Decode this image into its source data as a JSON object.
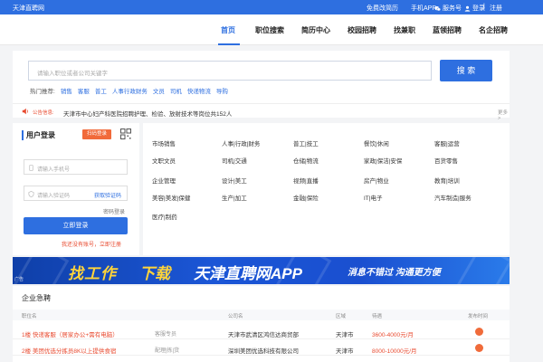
{
  "topbar": {
    "site_name": "天津直聘网",
    "links": [
      {
        "label": "免费改简历"
      },
      {
        "label": "手机APP"
      },
      {
        "label": "服务号"
      },
      {
        "label": "登录"
      },
      {
        "label": "注册"
      }
    ],
    "separator": "|"
  },
  "nav": {
    "items": [
      {
        "label": "首页",
        "active": true
      },
      {
        "label": "职位搜索"
      },
      {
        "label": "简历中心"
      },
      {
        "label": "校园招聘"
      },
      {
        "label": "找兼职"
      },
      {
        "label": "蓝领招聘"
      },
      {
        "label": "名企招聘"
      }
    ]
  },
  "search": {
    "placeholder": "请输入职位或者公司关键字",
    "button": "搜 索",
    "hot_label": "热门推荐:",
    "hot_keywords": [
      "销售",
      "客服",
      "普工",
      "人事行政财务",
      "文员",
      "司机",
      "快递物流",
      "导购"
    ]
  },
  "notice": {
    "label": "公告信息:",
    "text": "天津市中心妇产科医院招聘护理、检验、放射技术等岗位共152人",
    "more": "更多 >"
  },
  "login": {
    "title": "用户登录",
    "scan_button": "扫码登录",
    "phone_placeholder": "请输入手机号",
    "code_placeholder": "请输入验证码",
    "get_code": "获取验证码",
    "password_login": "密码登录",
    "submit": "立即登录",
    "register": "我还没有账号，立即注册"
  },
  "categories": [
    [
      "市场销售",
      "人事|行政|财务",
      "普工|技工",
      "餐饮|休闲",
      "客服|运营"
    ],
    [
      "文职文员",
      "司机|交通",
      "仓储|物流",
      "家政|保洁|安保",
      "百货零售"
    ],
    [
      "企业管理",
      "设计|美工",
      "视频|直播",
      "房产|物业",
      "教育|培训"
    ],
    [
      "美容|美发|保健",
      "生产|加工",
      "金融|保险",
      "IT|电子",
      "汽车制造|服务"
    ],
    [
      "医疗|制药"
    ]
  ],
  "banner": {
    "text1": "找工作",
    "text2": "下载",
    "text3": "天津直聘网APP",
    "text4": "消息不错过  沟通更方便",
    "ad": "广告"
  },
  "jobs": {
    "heading": "企业急聘",
    "columns": [
      "职位名",
      "公司名",
      "区域",
      "待遇",
      "发布时间"
    ],
    "rows": [
      {
        "title": "1楼  快递客服（居家办公+需有电脑）",
        "tag": "客服专员",
        "company": "天津市武清区鸿信达商贸部",
        "area": "天津市",
        "salary": "3600-4000元/月"
      },
      {
        "title": "2楼  美团优选分拣员8K以上提供食宿",
        "tag": "配理|拣|货",
        "company": "深圳美团优选科技有限公司",
        "area": "天津市",
        "salary": "8000-10000元/月"
      }
    ]
  },
  "colors": {
    "primary": "#2e6fe0",
    "accent": "#e84a2f",
    "orange": "#f16a3a"
  }
}
